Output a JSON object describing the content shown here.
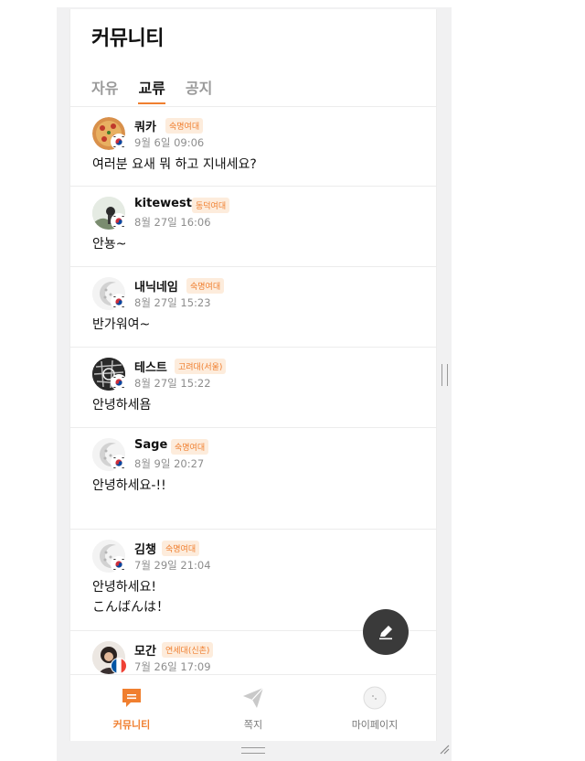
{
  "header": {
    "title": "커뮤니티"
  },
  "tabs": [
    {
      "label": "자유",
      "active": false
    },
    {
      "label": "교류",
      "active": true
    },
    {
      "label": "공지",
      "active": false
    }
  ],
  "posts": [
    {
      "name": "쿼카",
      "school": "숙명여대",
      "time": "9월 6일 09:06",
      "lines": [
        "여러분 요새 뭐 하고 지내세요?"
      ],
      "avatar": "pizza-avatar",
      "flag": "korea-flag"
    },
    {
      "name": "kitewest",
      "school": "동덕여대",
      "time": "8월 27일 16:06",
      "lines": [
        "안뇽~"
      ],
      "avatar": "photo-avatar",
      "flag": "korea-flag"
    },
    {
      "name": "내닉네임",
      "school": "숙명여대",
      "time": "8월 27일 15:23",
      "lines": [
        "반가워여~"
      ],
      "avatar": "default-avatar",
      "flag": "korea-flag"
    },
    {
      "name": "테스트",
      "school": "고려대(서울)",
      "time": "8월 27일 15:22",
      "lines": [
        "안녕하세욤"
      ],
      "avatar": "sketch-avatar",
      "flag": "korea-flag"
    },
    {
      "name": "Sage",
      "school": "숙명여대",
      "time": "8월 9일 20:27",
      "lines": [
        "안녕하세요-!!"
      ],
      "avatar": "default-avatar",
      "flag": "korea-flag"
    },
    {
      "name": "김챙",
      "school": "숙명여대",
      "time": "7월 29일 21:04",
      "lines": [
        "안녕하세요!",
        "こんばんは！"
      ],
      "avatar": "default-avatar",
      "flag": "korea-flag"
    },
    {
      "name": "모간",
      "school": "연세대(신촌)",
      "time": "7월 26일 17:09",
      "lines": [],
      "avatar": "person-avatar",
      "flag": "france-flag"
    }
  ],
  "fab": {
    "icon": "pencil-icon"
  },
  "bottom_nav": [
    {
      "label": "커뮤니티",
      "icon": "chat-icon",
      "active": true
    },
    {
      "label": "쪽지",
      "icon": "send-icon",
      "active": false
    },
    {
      "label": "마이페이지",
      "icon": "profile-icon",
      "active": false
    }
  ],
  "colors": {
    "accent": "#f07f2f",
    "badge_bg": "#fdecdc",
    "fab": "#3a3a3a"
  }
}
